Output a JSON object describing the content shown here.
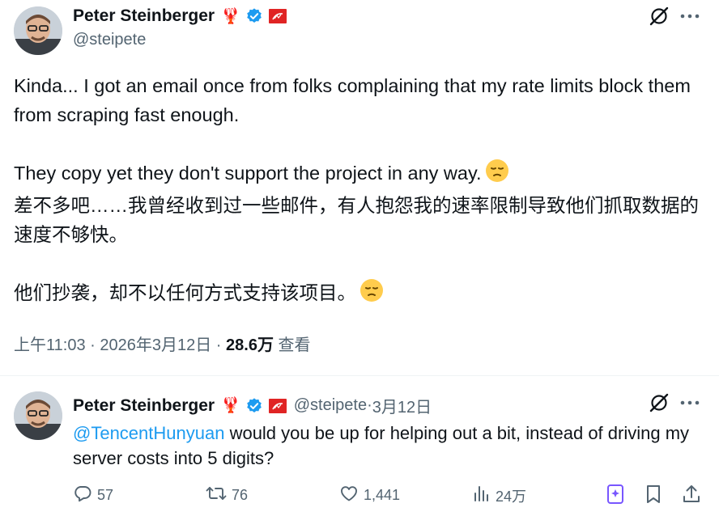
{
  "tweet": {
    "author": {
      "name": "Peter Steinberger",
      "lobster": "🦞",
      "handle": "@steipete"
    },
    "paragraphs": [
      "Kinda... I got an email once from folks complaining that my rate limits block them from scraping fast enough.",
      "They copy yet they don't support the project in any way.",
      "差不多吧……我曾经收到过一些邮件，有人抱怨我的速率限制导致他们抓取数据的速度不够快。",
      "他们抄袭，却不以任何方式支持该项目。"
    ],
    "time": "上午11:03",
    "date": "2026年3月12日",
    "views": "28.6万",
    "views_label": "查看",
    "sep": " · "
  },
  "reply": {
    "author": {
      "name": "Peter Steinberger",
      "lobster": "🦞",
      "handle": "@steipete",
      "date": "3月12日",
      "sep": " · "
    },
    "mention": "@TencentHunyuan",
    "text": " would you be up for helping out a bit, instead of driving my server costs into 5 digits?",
    "actions": {
      "replies": "57",
      "reposts": "76",
      "likes": "1,441",
      "views": "24万"
    }
  },
  "colors": {
    "text": "#0f1419",
    "muted": "#536471",
    "accent": "#1d9bf0",
    "grok_purple": "#7856ff"
  },
  "icons": [
    "verified-badge-icon",
    "red-flag-icon",
    "grok-slash-icon",
    "more-icon",
    "sad-face-emoji",
    "reply-icon",
    "repost-icon",
    "like-icon",
    "views-icon",
    "grok-icon",
    "bookmark-icon",
    "share-icon"
  ]
}
